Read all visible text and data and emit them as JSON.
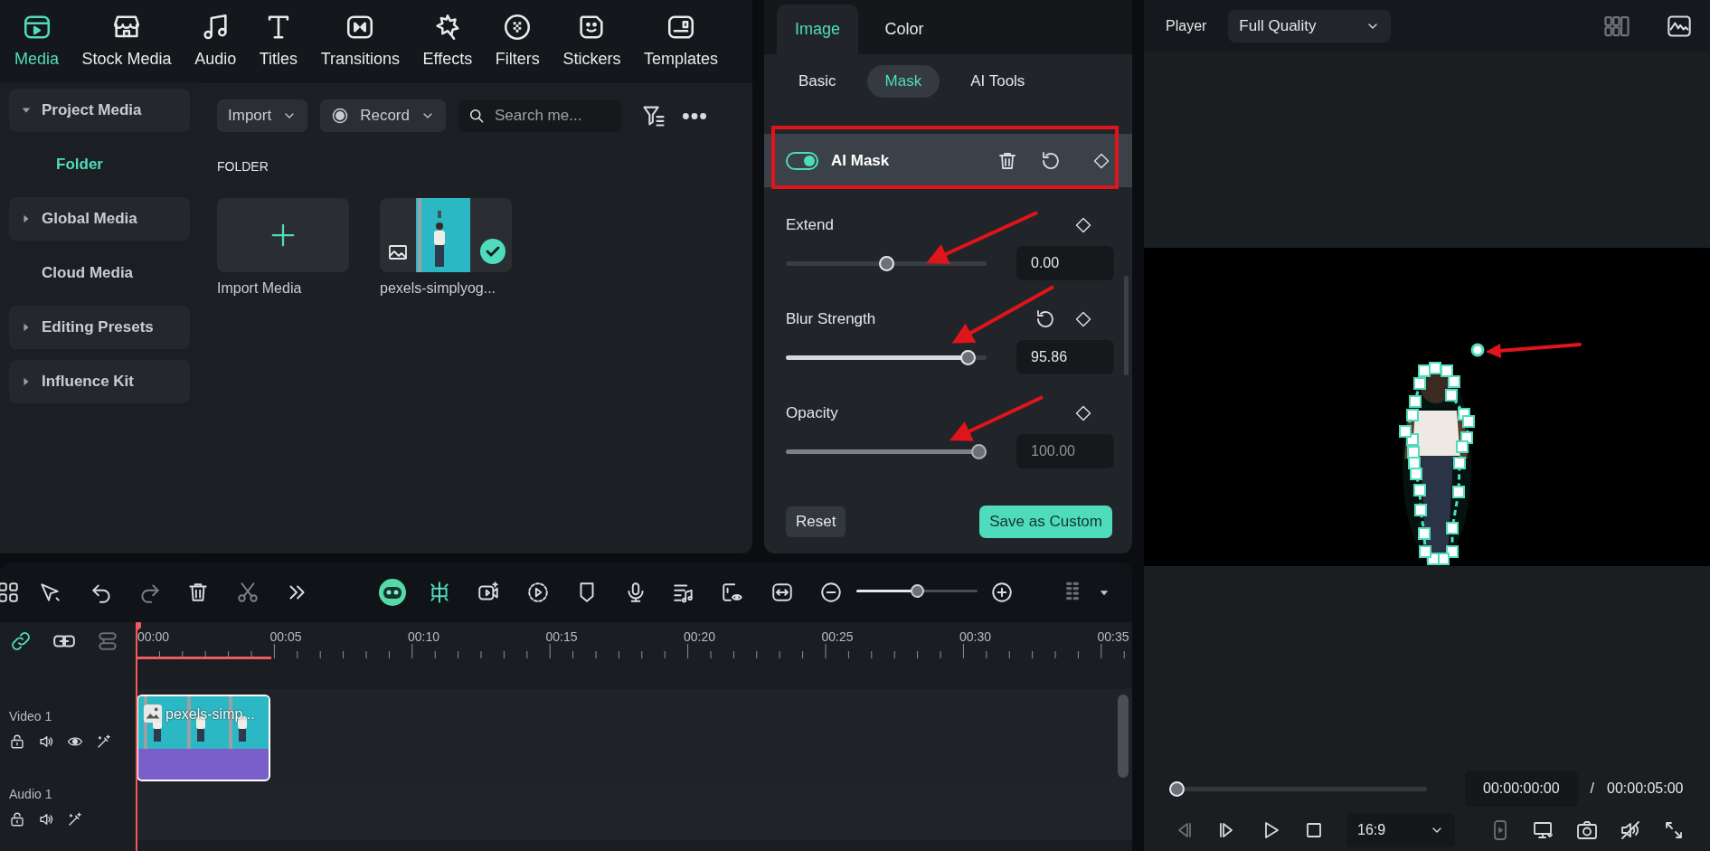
{
  "nav_tabs": [
    {
      "label": "Media",
      "selected": true
    },
    {
      "label": "Stock Media",
      "selected": false
    },
    {
      "label": "Audio",
      "selected": false
    },
    {
      "label": "Titles",
      "selected": false
    },
    {
      "label": "Transitions",
      "selected": false
    },
    {
      "label": "Effects",
      "selected": false
    },
    {
      "label": "Filters",
      "selected": false
    },
    {
      "label": "Stickers",
      "selected": false
    },
    {
      "label": "Templates",
      "selected": false
    }
  ],
  "sidebar": {
    "items": [
      {
        "label": "Project Media",
        "kind": "group",
        "expanded": true,
        "selected": false
      },
      {
        "label": "Folder",
        "kind": "folder",
        "selected": true
      },
      {
        "label": "Global Media",
        "kind": "group",
        "expanded": false,
        "selected": false
      },
      {
        "label": "Cloud Media",
        "kind": "plain",
        "selected": false
      },
      {
        "label": "Editing Presets",
        "kind": "group",
        "expanded": false,
        "selected": false
      },
      {
        "label": "Influence Kit",
        "kind": "group",
        "expanded": false,
        "selected": false
      }
    ]
  },
  "media_toolbar": {
    "import": "Import",
    "record": "Record",
    "search": {
      "placeholder": "Search me..."
    }
  },
  "section_heading": "FOLDER",
  "media_items": [
    {
      "kind": "import",
      "label": "Import Media"
    },
    {
      "kind": "clip",
      "label": "pexels-simplyog...",
      "selected": true
    }
  ],
  "properties": {
    "tabs": [
      {
        "label": "Image",
        "selected": true
      },
      {
        "label": "Color",
        "selected": false
      }
    ],
    "subtabs": [
      {
        "label": "Basic",
        "selected": false
      },
      {
        "label": "Mask",
        "selected": true
      },
      {
        "label": "AI Tools",
        "selected": false
      }
    ],
    "ai_mask": {
      "label": "AI Mask",
      "on": true
    },
    "sliders": [
      {
        "label": "Extend",
        "kind": "bipolar",
        "level": 0.5,
        "reading": "0.00",
        "resettable": false,
        "disabled": false
      },
      {
        "label": "Blur Strength",
        "kind": "normal",
        "level": 0.94,
        "reading": "95.86",
        "resettable": true,
        "disabled": false
      },
      {
        "label": "Opacity",
        "kind": "normal",
        "level": 1,
        "reading": "100.00",
        "resettable": false,
        "disabled": true
      }
    ],
    "reset_button": "Reset",
    "save_button": "Save as Custom"
  },
  "player": {
    "title": "Player",
    "quality": "Full Quality",
    "level": 0,
    "current_time": "00:00:00:00",
    "separator": "/",
    "total_time": "00:00:05:00",
    "aspect": "16:9"
  },
  "timeline": {
    "zoom_slider": {
      "level": 0.5
    },
    "render_bar": {
      "level": 0.136
    },
    "ruler": [
      "00:00",
      "00:05",
      "00:10",
      "00:15",
      "00:20",
      "00:25",
      "00:30",
      "00:35"
    ],
    "tracks": [
      {
        "label": "Video 1",
        "kind": "video"
      },
      {
        "label": "Audio 1",
        "kind": "audio"
      }
    ],
    "clip": {
      "label": "pexels-simp...",
      "selected": true
    }
  }
}
